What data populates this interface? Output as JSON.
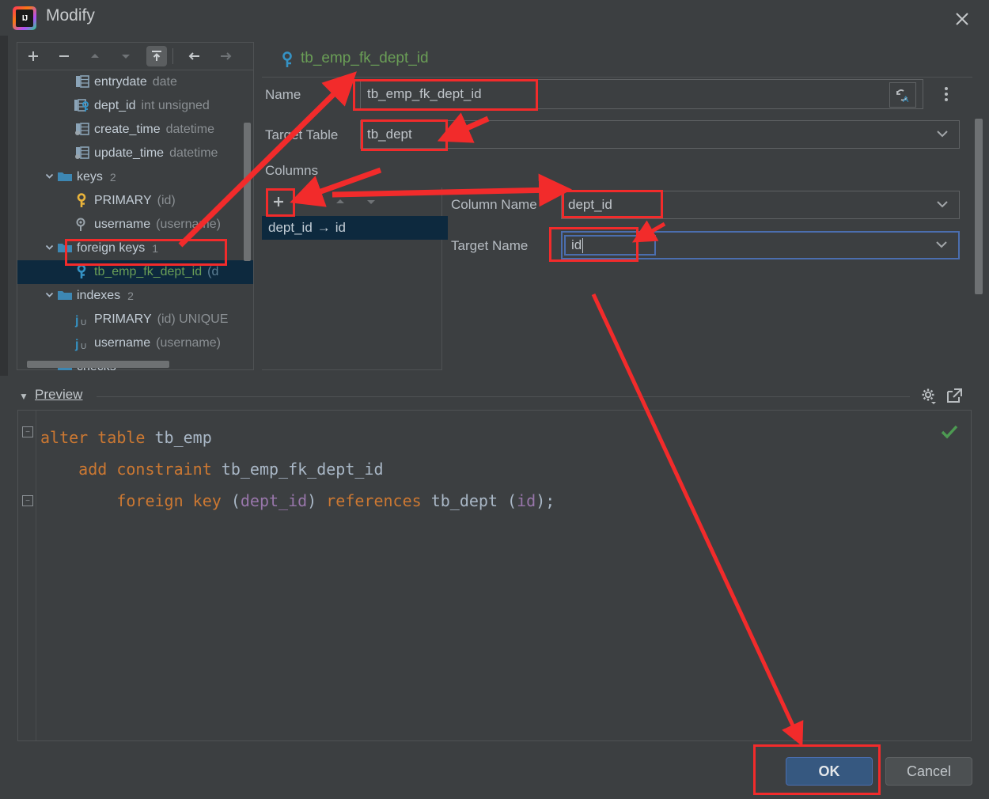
{
  "window": {
    "title": "Modify",
    "logo_icon": "intellij-idea-icon",
    "close_icon": "close-icon"
  },
  "tree_toolbar": {
    "buttons": [
      {
        "name": "add-button",
        "icon": "plus-icon",
        "enabled": true
      },
      {
        "name": "remove-button",
        "icon": "minus-icon",
        "enabled": true
      },
      {
        "name": "move-up-button",
        "icon": "arrow-up-icon",
        "enabled": false
      },
      {
        "name": "move-down-button",
        "icon": "arrow-down-icon",
        "enabled": false
      },
      {
        "name": "revert-button",
        "icon": "apply-upload-icon",
        "enabled": true,
        "selected": true
      },
      {
        "name": "back-button",
        "icon": "arrow-left-icon",
        "enabled": true
      },
      {
        "name": "forward-button",
        "icon": "arrow-right-icon",
        "enabled": false
      }
    ]
  },
  "tree": {
    "items": [
      {
        "name": "entrydate",
        "type": "date",
        "icon": "column-icon",
        "indent": 2,
        "twisty": "",
        "count": ""
      },
      {
        "name": "dept_id",
        "type": "int unsigned",
        "icon": "column-fk-icon",
        "indent": 2,
        "twisty": "",
        "count": ""
      },
      {
        "name": "create_time",
        "type": "datetime",
        "icon": "column-default-icon",
        "indent": 2,
        "twisty": "",
        "count": ""
      },
      {
        "name": "update_time",
        "type": "datetime",
        "icon": "column-default-icon",
        "indent": 2,
        "twisty": "",
        "count": ""
      },
      {
        "name": "keys",
        "type": "",
        "icon": "folder-icon",
        "indent": 1,
        "twisty": "expanded",
        "count": "2"
      },
      {
        "name": "PRIMARY",
        "type": "(id)",
        "icon": "key-yellow-icon",
        "indent": 2,
        "twisty": "",
        "count": ""
      },
      {
        "name": "username",
        "type": "(username)",
        "icon": "key-unique-icon",
        "indent": 2,
        "twisty": "",
        "count": ""
      },
      {
        "name": "foreign keys",
        "type": "",
        "icon": "folder-icon",
        "indent": 1,
        "twisty": "expanded",
        "count": "1"
      },
      {
        "name": "tb_emp_fk_dept_id",
        "type": "(d",
        "icon": "key-blue-icon",
        "indent": 2,
        "twisty": "",
        "count": "",
        "selected": true
      },
      {
        "name": "indexes",
        "type": "",
        "icon": "folder-icon",
        "indent": 1,
        "twisty": "expanded",
        "count": "2"
      },
      {
        "name": "PRIMARY",
        "type": "(id) UNIQUE",
        "icon": "index-icon",
        "indent": 2,
        "twisty": "",
        "count": ""
      },
      {
        "name": "username",
        "type": "(username)",
        "icon": "index-icon",
        "indent": 2,
        "twisty": "",
        "count": ""
      },
      {
        "name": "checks",
        "type": "",
        "icon": "folder-icon",
        "indent": 1,
        "twisty": "",
        "count": ""
      }
    ]
  },
  "detail": {
    "header_title": "tb_emp_fk_dept_id",
    "header_icon": "key-blue-icon",
    "name_label": "Name",
    "name_value": "tb_emp_fk_dept_id",
    "name_case_icon": "case-convert-icon",
    "name_more_icon": "more-vertical-icon",
    "target_table_label": "Target Table",
    "target_table_value": "tb_dept",
    "columns_label": "Columns",
    "column_name_label": "Column Name",
    "column_name_value": "dept_id",
    "target_name_label": "Target Name",
    "target_name_value": "id"
  },
  "columns_toolbar": {
    "buttons": [
      {
        "name": "add-column-button",
        "icon": "plus-icon",
        "enabled": true
      },
      {
        "name": "remove-column-button",
        "icon": "minus-icon",
        "enabled": true
      },
      {
        "name": "column-up-button",
        "icon": "arrow-up-icon",
        "enabled": false
      },
      {
        "name": "column-down-button",
        "icon": "arrow-down-icon",
        "enabled": false
      }
    ]
  },
  "columns_list": {
    "rows": [
      {
        "source": "dept_id",
        "arrow": "→",
        "target": "id",
        "selected": true
      }
    ]
  },
  "preview": {
    "label": "Preview",
    "collapse_icon": "triangle-down-icon",
    "settings_icon": "gear-icon",
    "expand_icon": "open-external-icon",
    "valid_icon": "checkmark-icon",
    "sql_lines": [
      {
        "indent": 0,
        "tokens": [
          {
            "t": "alter ",
            "c": "kw"
          },
          {
            "t": "table ",
            "c": "kw"
          },
          {
            "t": "tb_emp",
            "c": "id2"
          }
        ]
      },
      {
        "indent": 1,
        "tokens": [
          {
            "t": "add ",
            "c": "kw"
          },
          {
            "t": "constraint ",
            "c": "kw"
          },
          {
            "t": "tb_emp_fk_dept_id",
            "c": "id2"
          }
        ]
      },
      {
        "indent": 2,
        "tokens": [
          {
            "t": "foreign ",
            "c": "kw"
          },
          {
            "t": "key ",
            "c": "kw"
          },
          {
            "t": "(",
            "c": "id2"
          },
          {
            "t": "dept_id",
            "c": "col"
          },
          {
            "t": ") ",
            "c": "id2"
          },
          {
            "t": "references ",
            "c": "kw"
          },
          {
            "t": "tb_dept ",
            "c": "id2"
          },
          {
            "t": "(",
            "c": "id2"
          },
          {
            "t": "id",
            "c": "col"
          },
          {
            "t": ");",
            "c": "id2"
          }
        ]
      }
    ]
  },
  "footer": {
    "ok_label": "OK",
    "cancel_label": "Cancel"
  },
  "colors": {
    "background": "#3c3f41",
    "selection": "#0d293e",
    "accent_blue": "#365880",
    "annotation_red": "#f22b2b",
    "sql_keyword": "#cc7832",
    "sql_column": "#9876aa",
    "green_text": "#6a9e56",
    "focus_border": "#4b6eaf"
  }
}
